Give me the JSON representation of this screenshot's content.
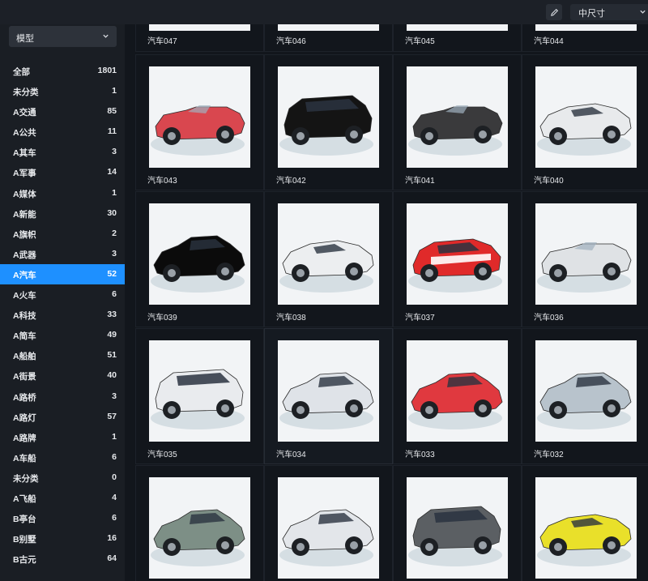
{
  "topbar": {
    "size_label": "中尺寸"
  },
  "sidebar": {
    "dropdown_label": "模型",
    "categories": [
      {
        "label": "全部",
        "count": "1801"
      },
      {
        "label": "未分类",
        "count": "1"
      },
      {
        "label": "A交通",
        "count": "85"
      },
      {
        "label": "A公共",
        "count": "11"
      },
      {
        "label": "A其车",
        "count": "3"
      },
      {
        "label": "A军事",
        "count": "14"
      },
      {
        "label": "A媒体",
        "count": "1"
      },
      {
        "label": "A新能",
        "count": "30"
      },
      {
        "label": "A旗帜",
        "count": "2"
      },
      {
        "label": "A武器",
        "count": "3"
      },
      {
        "label": "A汽车",
        "count": "52",
        "active": true
      },
      {
        "label": "A火车",
        "count": "6"
      },
      {
        "label": "A科技",
        "count": "33"
      },
      {
        "label": "A简车",
        "count": "49"
      },
      {
        "label": "A船舶",
        "count": "51"
      },
      {
        "label": "A街景",
        "count": "40"
      },
      {
        "label": "A路桥",
        "count": "3"
      },
      {
        "label": "A路灯",
        "count": "57"
      },
      {
        "label": "A路牌",
        "count": "1"
      },
      {
        "label": "A车船",
        "count": "6"
      },
      {
        "label": "未分类",
        "count": "0"
      },
      {
        "label": "A飞船",
        "count": "4"
      },
      {
        "label": "B亭台",
        "count": "6"
      },
      {
        "label": "B别墅",
        "count": "16"
      },
      {
        "label": "B古元",
        "count": "64"
      }
    ]
  },
  "grid": {
    "partial_row": [
      "汽车047",
      "汽车046",
      "汽车045",
      "汽车044"
    ],
    "rows": [
      [
        {
          "name": "汽车043",
          "color": "#d9474f",
          "style": "convertible"
        },
        {
          "name": "汽车042",
          "color": "#141414",
          "style": "suv"
        },
        {
          "name": "汽车041",
          "color": "#3a3a3c",
          "style": "convertible"
        },
        {
          "name": "汽车040",
          "color": "#e8eaec",
          "style": "coupe"
        }
      ],
      [
        {
          "name": "汽车039",
          "color": "#0b0b0b",
          "style": "sedan"
        },
        {
          "name": "汽车038",
          "color": "#eceef0",
          "style": "coupe"
        },
        {
          "name": "汽车037",
          "color": "#e02a2a",
          "style": "rally"
        },
        {
          "name": "汽车036",
          "color": "#dfe2e5",
          "style": "convertible"
        }
      ],
      [
        {
          "name": "汽车035",
          "color": "#e9ebee",
          "style": "suv"
        },
        {
          "name": "汽车034",
          "color": "#dfe3e8",
          "style": "sedan",
          "highlight": true
        },
        {
          "name": "汽车033",
          "color": "#e0393f",
          "style": "sedan"
        },
        {
          "name": "汽车032",
          "color": "#b8c3cc",
          "style": "sedan"
        }
      ],
      [
        {
          "name": "",
          "color": "#7d8f86",
          "style": "sedan"
        },
        {
          "name": "",
          "color": "#e3e6ea",
          "style": "sedan"
        },
        {
          "name": "",
          "color": "#5b5f63",
          "style": "suv"
        },
        {
          "name": "",
          "color": "#e9e02a",
          "style": "coupe"
        }
      ]
    ]
  }
}
